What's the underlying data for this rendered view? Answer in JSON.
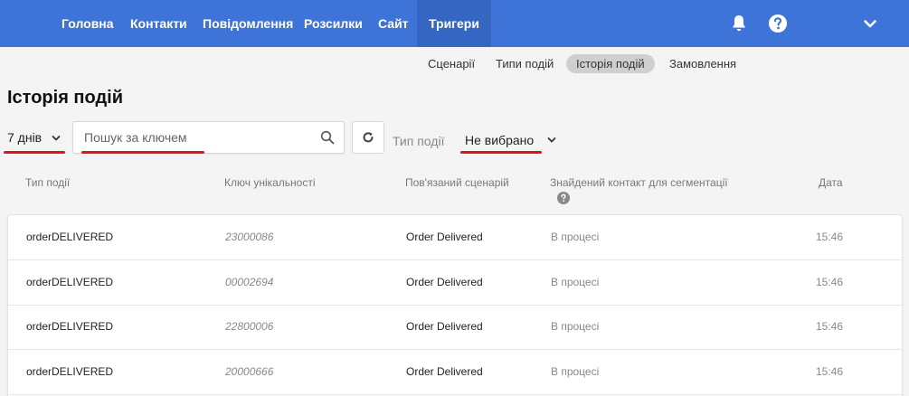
{
  "nav": {
    "items": [
      {
        "label": "Головна"
      },
      {
        "label": "Контакти"
      },
      {
        "label": "Повідомлення"
      },
      {
        "label": "Розсилки"
      },
      {
        "label": "Сайт"
      },
      {
        "label": "Тригери",
        "active": true
      }
    ],
    "icons": [
      "bell-icon",
      "help-icon",
      "chevron-down-icon"
    ],
    "colors": {
      "background": "#3e74d8",
      "active": "#3566c2"
    }
  },
  "subnav": {
    "items": [
      {
        "label": "Сценарії"
      },
      {
        "label": "Типи подій"
      },
      {
        "label": "Історія подій",
        "active": true
      },
      {
        "label": "Замовлення"
      }
    ]
  },
  "page": {
    "title": "Історія подій"
  },
  "filters": {
    "period": "7 днів",
    "search_placeholder": "Пошук за ключем",
    "search_value": "",
    "event_type_label": "Тип події",
    "event_type_value": "Не вибрано",
    "highlight_color": "#e0141b"
  },
  "table": {
    "headers": {
      "type": "Тип події",
      "key": "Ключ унікальності",
      "scenario": "Пов'язаний сценарій",
      "segment": "Знайдений контакт для сегментації",
      "date": "Дата"
    },
    "rows": [
      {
        "type": "orderDELIVERED",
        "key": "23000086",
        "scenario": "Order Delivered",
        "segment": "В процесі",
        "date": "15:46"
      },
      {
        "type": "orderDELIVERED",
        "key": "00002694",
        "scenario": "Order Delivered",
        "segment": "В процесі",
        "date": "15:46"
      },
      {
        "type": "orderDELIVERED",
        "key": "22800006",
        "scenario": "Order Delivered",
        "segment": "В процесі",
        "date": "15:46"
      },
      {
        "type": "orderDELIVERED",
        "key": "20000666",
        "scenario": "Order Delivered",
        "segment": "В процесі",
        "date": "15:46"
      }
    ]
  }
}
